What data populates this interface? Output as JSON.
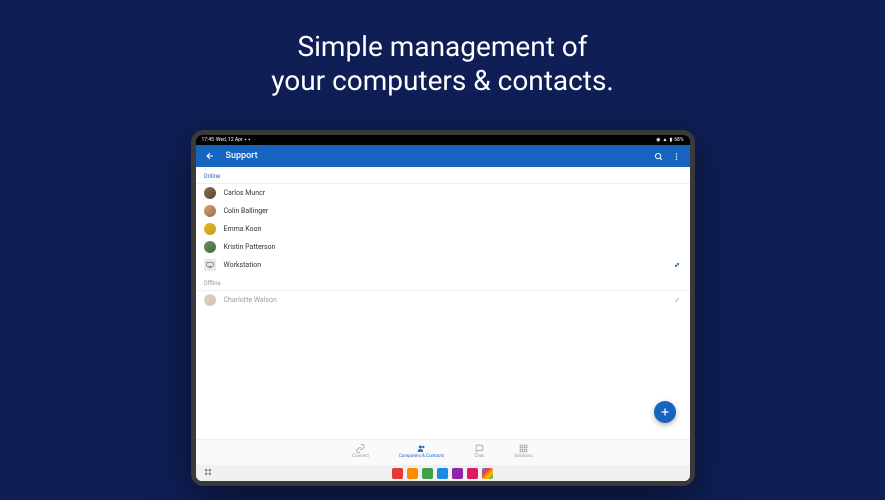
{
  "headline_line1": "Simple management of",
  "headline_line2": "your computers & contacts.",
  "status": {
    "time": "17:45",
    "date": "Wed, 12 Apr",
    "battery": "68%"
  },
  "header": {
    "title": "Support"
  },
  "sections": {
    "online_label": "Online",
    "offline_label": "Offline"
  },
  "online_items": [
    {
      "name": "Carlos Muncr",
      "avatar_bg": "linear-gradient(135deg,#8b6f47,#5a4a3a)"
    },
    {
      "name": "Colin Ballinger",
      "avatar_bg": "linear-gradient(135deg,#d4a373,#9c6f44)"
    },
    {
      "name": "Emma Koon",
      "avatar_bg": "linear-gradient(135deg,#e8b923,#c49a1a)"
    },
    {
      "name": "Kristin Patterson",
      "avatar_bg": "linear-gradient(135deg,#6b8e5a,#4a6b3e)"
    },
    {
      "name": "Workstation",
      "is_computer": true
    }
  ],
  "offline_items": [
    {
      "name": "Charlotte Walson",
      "avatar_bg": "linear-gradient(135deg,#c8a882,#a08862)"
    }
  ],
  "nav": [
    {
      "label": "Connect",
      "icon": "link"
    },
    {
      "label": "Computers & Contacts",
      "icon": "people",
      "active": true
    },
    {
      "label": "Chat",
      "icon": "chat"
    },
    {
      "label": "Solutions",
      "icon": "apps"
    }
  ],
  "dock": [
    {
      "bg": "#e53935"
    },
    {
      "bg": "#fb8c00"
    },
    {
      "bg": "#43a047"
    },
    {
      "bg": "#1e88e5"
    },
    {
      "bg": "#8e24aa"
    },
    {
      "bg": "#d81b60"
    },
    {
      "bg": "linear-gradient(135deg,#4285f4,#ea4335,#fbbc05,#34a853)"
    }
  ]
}
